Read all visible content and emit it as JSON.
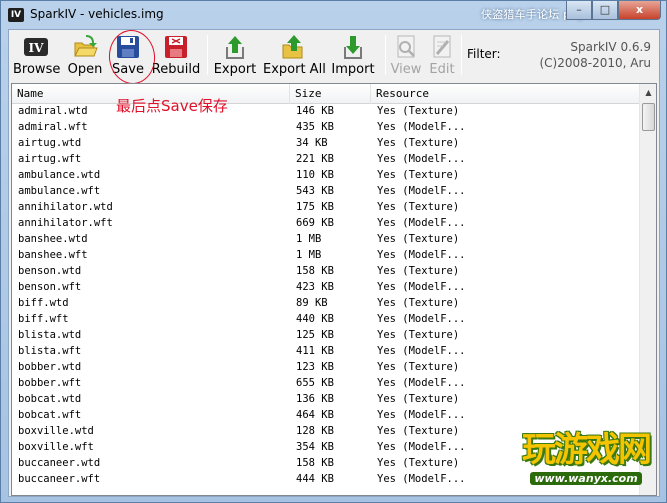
{
  "window": {
    "app_icon": "IV",
    "title": "SparkIV - vehicles.img",
    "watermark": "侠盗猎车手论坛 pcgta.5d6d.com",
    "buttons": {
      "minimize": "–",
      "maximize": "□",
      "close": "x"
    }
  },
  "toolbar": {
    "buttons": [
      {
        "id": "browse",
        "label": "Browse",
        "icon": "iv-logo-icon",
        "enabled": true
      },
      {
        "id": "open",
        "label": "Open",
        "icon": "open-folder-icon",
        "enabled": true
      },
      {
        "id": "save",
        "label": "Save",
        "icon": "floppy-disk-icon",
        "enabled": true
      },
      {
        "id": "rebuild",
        "label": "Rebuild",
        "icon": "rebuild-disk-icon",
        "enabled": true
      },
      {
        "id": "export",
        "label": "Export",
        "icon": "export-arrow-icon",
        "enabled": true
      },
      {
        "id": "export_all",
        "label": "Export All",
        "icon": "export-all-icon",
        "enabled": true
      },
      {
        "id": "import",
        "label": "Import",
        "icon": "import-arrow-icon",
        "enabled": true
      },
      {
        "id": "view",
        "label": "View",
        "icon": "view-icon",
        "enabled": false
      },
      {
        "id": "edit",
        "label": "Edit",
        "icon": "edit-icon",
        "enabled": false
      }
    ],
    "filter_label": "Filter:",
    "brand_line1": "SparkIV 0.6.9",
    "brand_line2": "(C)2008-2010, Aru"
  },
  "annotation": "最后点Save保存",
  "colors": {
    "annotation": "#e0102a",
    "icon_green": "#2e9a2e",
    "icon_red": "#c8202a",
    "icon_blue": "#274c9c"
  },
  "list": {
    "columns": [
      "Name",
      "Size",
      "Resource"
    ],
    "rows": [
      [
        "admiral.wtd",
        "146 KB",
        "Yes (Texture)"
      ],
      [
        "admiral.wft",
        "435 KB",
        "Yes (ModelF..."
      ],
      [
        "airtug.wtd",
        "34 KB",
        "Yes (Texture)"
      ],
      [
        "airtug.wft",
        "221 KB",
        "Yes (ModelF..."
      ],
      [
        "ambulance.wtd",
        "110 KB",
        "Yes (Texture)"
      ],
      [
        "ambulance.wft",
        "543 KB",
        "Yes (ModelF..."
      ],
      [
        "annihilator.wtd",
        "175 KB",
        "Yes (Texture)"
      ],
      [
        "annihilator.wft",
        "669 KB",
        "Yes (ModelF..."
      ],
      [
        "banshee.wtd",
        "1 MB",
        "Yes (Texture)"
      ],
      [
        "banshee.wft",
        "1 MB",
        "Yes (ModelF..."
      ],
      [
        "benson.wtd",
        "158 KB",
        "Yes (Texture)"
      ],
      [
        "benson.wft",
        "423 KB",
        "Yes (ModelF..."
      ],
      [
        "biff.wtd",
        "89 KB",
        "Yes (Texture)"
      ],
      [
        "biff.wft",
        "440 KB",
        "Yes (ModelF..."
      ],
      [
        "blista.wtd",
        "125 KB",
        "Yes (Texture)"
      ],
      [
        "blista.wft",
        "411 KB",
        "Yes (ModelF..."
      ],
      [
        "bobber.wtd",
        "123 KB",
        "Yes (Texture)"
      ],
      [
        "bobber.wft",
        "655 KB",
        "Yes (ModelF..."
      ],
      [
        "bobcat.wtd",
        "136 KB",
        "Yes (Texture)"
      ],
      [
        "bobcat.wft",
        "464 KB",
        "Yes (ModelF..."
      ],
      [
        "boxville.wtd",
        "128 KB",
        "Yes (Texture)"
      ],
      [
        "boxville.wft",
        "354 KB",
        "Yes (ModelF..."
      ],
      [
        "buccaneer.wtd",
        "158 KB",
        "Yes (Texture)"
      ],
      [
        "buccaneer.wft",
        "444 KB",
        "Yes (ModelF..."
      ]
    ]
  },
  "logo": {
    "text": "玩游戏网",
    "url": "www.wanyx.com"
  }
}
